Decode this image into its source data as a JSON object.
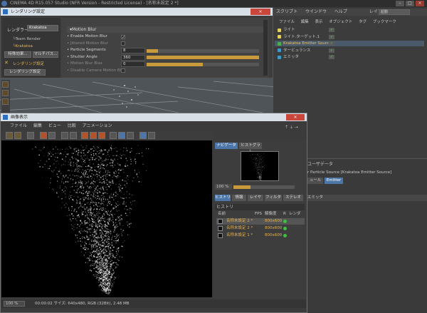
{
  "app": {
    "title": "CINEMA 4D R15.057 Studio (NFR Version - Restricted License) - [名称未設定 2 *]",
    "menu": [
      "スクリプト",
      "ウインドウ",
      "ヘルプ"
    ],
    "layout_label": "レイアウト:",
    "layout_value": "起動"
  },
  "object_manager": {
    "menu": [
      "ファイル",
      "編集",
      "表示",
      "オブジェクト",
      "タグ",
      "ブックマーク"
    ],
    "items": [
      {
        "label": "ライト",
        "icon_color": "#e0d060"
      },
      {
        "label": "ライト.ターゲット.1",
        "icon_color": "#e0d060"
      },
      {
        "label": "Krakatoa Emitter Source",
        "icon_color": "#4ab04a",
        "selected": true
      },
      {
        "label": "タービュランス",
        "icon_color": "#3a9acb"
      },
      {
        "label": "エミッタ",
        "icon_color": "#3a9acb"
      }
    ]
  },
  "attribute_manager": {
    "header": "ユーザデータ",
    "subtitle": "r Particle Source [Krakatoa Emitter Source]",
    "tabs": [
      {
        "label": "ュール"
      },
      {
        "label": "Emitter",
        "active": true
      }
    ],
    "emitter_row": "エミッタ"
  },
  "render_settings": {
    "title": "レンダリング設定",
    "renderer_label": "レンダラー",
    "renderer_value": "Krakatoa",
    "tree": [
      "Team Render",
      "Krakatoa"
    ],
    "buttons": {
      "effect": "特殊効果...",
      "multipass": "マルチパス...",
      "settings": "レンダリング設定",
      "settings2": "レンダリング設定"
    },
    "section": "Motion Blur",
    "params": [
      {
        "label": "Enable Motion Blur",
        "checked": true,
        "type": "check"
      },
      {
        "label": "Jittered Motion Blur",
        "checked": false,
        "type": "check",
        "dim": true
      },
      {
        "label": "Particle Segments",
        "value": "8",
        "fill": 0.1,
        "type": "slider"
      },
      {
        "label": "Shutter Angle",
        "value": "360",
        "fill": 1.0,
        "type": "slider"
      },
      {
        "label": "Motion Blur Bias",
        "value": "0",
        "fill": 0.5,
        "type": "slider",
        "dim": true
      },
      {
        "label": "Disable Camera Motion Blur",
        "checked": false,
        "type": "check",
        "dim": true
      }
    ]
  },
  "picture_viewer": {
    "title": "画像表示",
    "menu": [
      "ファイル",
      "編集",
      "ビュー",
      "比較",
      "アニメーション"
    ],
    "tabs_top": [
      {
        "label": "ナビゲータ",
        "active": true
      },
      {
        "label": "ヒストグラム"
      }
    ],
    "zoom": "100 %",
    "zoom_fill": 0.28,
    "tabs_bottom": [
      {
        "label": "ヒストリ",
        "active": true
      },
      {
        "label": "情報"
      },
      {
        "label": "レイヤ"
      },
      {
        "label": "フィルタ"
      },
      {
        "label": "ステレオ"
      }
    ],
    "history_header": "ヒストリ",
    "history_cols": [
      "名前",
      "FPS",
      "解像度",
      "R",
      "レンダ"
    ],
    "history_rows": [
      {
        "name": "名称未設定 2 *",
        "res": "800x600",
        "dot": "#3fbf3f",
        "selected": true
      },
      {
        "name": "名称未設定 2 *",
        "res": "800x600",
        "dot": "#3fbf3f"
      },
      {
        "name": "名称未設定 1 *",
        "res": "800x600",
        "dot": "#3fbf3f"
      }
    ],
    "status_zoom": "100 %",
    "status_text": "00:00:02   サイズ: 640x480, RGB (32Bit), 2.48 MB"
  }
}
